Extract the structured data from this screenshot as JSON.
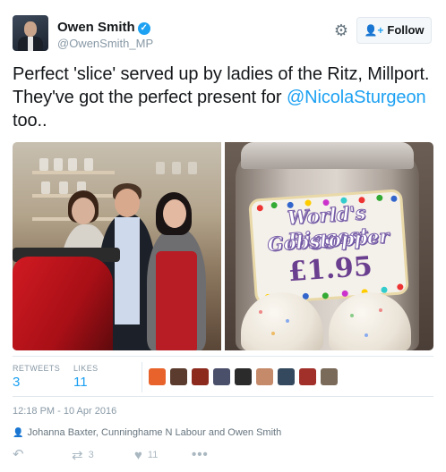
{
  "author": {
    "name": "Owen Smith",
    "handle": "@OwenSmith_MP",
    "verified_icon": "✓"
  },
  "header": {
    "settings_icon": "gear-icon",
    "follow_label": "Follow",
    "follow_icon": "add-user-icon"
  },
  "tweet": {
    "text_before": "Perfect 'slice' served up by ladies of the Ritz, Millport. They've got the perfect present for ",
    "mention": "@NicolaSturgeon",
    "text_after": " too.."
  },
  "media": {
    "right_photo_label": {
      "line1": "World's Biggest",
      "line2": "Gobstopper",
      "price": "£1.95"
    }
  },
  "stats": {
    "retweets_label": "RETWEETS",
    "retweets_value": "3",
    "likes_label": "LIKES",
    "likes_value": "11"
  },
  "likers": [
    {
      "color": "#e8632b"
    },
    {
      "color": "#5a3b2e"
    },
    {
      "color": "#8c2a1e"
    },
    {
      "color": "#4a4f6a"
    },
    {
      "color": "#2b2b2b"
    },
    {
      "color": "#c58a6a"
    },
    {
      "color": "#35495e"
    },
    {
      "color": "#a2302a"
    },
    {
      "color": "#7a6a5a"
    }
  ],
  "timestamp": "12:18 PM - 10 Apr 2016",
  "context": "Johanna Baxter, Cunninghame N Labour and Owen Smith",
  "actions": {
    "reply_icon": "reply-icon",
    "retweet_count": "3",
    "like_count": "11",
    "more_icon": "more-icon"
  }
}
